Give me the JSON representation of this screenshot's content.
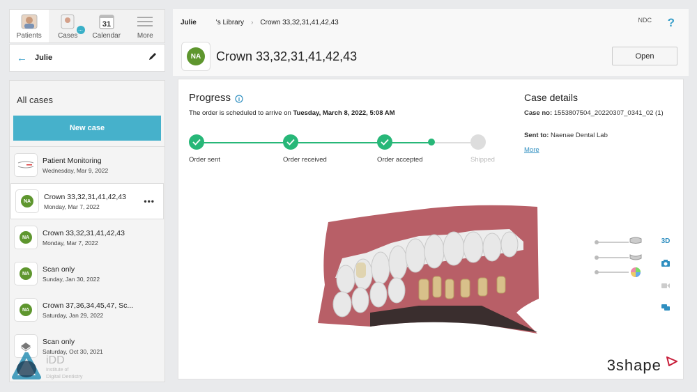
{
  "nav": {
    "tabs": [
      {
        "label": "Patients",
        "icon": "patients-icon"
      },
      {
        "label": "Cases",
        "icon": "cases-icon"
      },
      {
        "label": "Calendar",
        "icon": "calendar-icon"
      },
      {
        "label": "More",
        "icon": "menu-icon"
      }
    ],
    "calendar_day": "31",
    "cases_badge": "..."
  },
  "patient": {
    "name": "Julie"
  },
  "cases_panel": {
    "title": "All cases",
    "new_case_label": "New case",
    "items": [
      {
        "name": "Patient Monitoring",
        "date": "Wednesday, Mar 9, 2022",
        "thumb": "monitoring"
      },
      {
        "name": "Crown 33,32,31,41,42,43",
        "date": "Monday, Mar 7, 2022",
        "thumb": "NA"
      },
      {
        "name": "Crown 33,32,31,41,42,43",
        "date": "Monday, Mar 7, 2022",
        "thumb": "NA"
      },
      {
        "name": "Scan only",
        "date": "Sunday, Jan 30, 2022",
        "thumb": "NA"
      },
      {
        "name": "Crown 37,36,34,45,47, Sc...",
        "date": "Saturday, Jan 29, 2022",
        "thumb": "NA"
      },
      {
        "name": "Scan only",
        "date": "Saturday, Oct 30, 2021",
        "thumb": "scan"
      }
    ],
    "more_icon": "ellipsis-icon"
  },
  "header": {
    "owner": "Julie",
    "library": "'s Library",
    "current": "Crown 33,32,31,41,42,43",
    "ndc": "NDC",
    "help": "?"
  },
  "case": {
    "initials": "NA",
    "title": "Crown 33,32,31,41,42,43",
    "open_label": "Open"
  },
  "progress": {
    "title": "Progress",
    "arrival_prefix": "The order is scheduled to arrive on ",
    "arrival_date": "Tuesday, March 8, 2022, 5:08 AM",
    "steps": [
      {
        "label": "Order sent",
        "done": true
      },
      {
        "label": "Order received",
        "done": true
      },
      {
        "label": "Order accepted",
        "done": true
      },
      {
        "label": "Shipped",
        "done": false
      }
    ]
  },
  "case_details": {
    "title": "Case details",
    "case_no_label": "Case no:",
    "case_no": "1553807504_20220307_0341_02 (1)",
    "sent_to_label": "Sent to:",
    "sent_to": "Naenae Dental Lab",
    "more_label": "More"
  },
  "viewer": {
    "mode_3d": "3D",
    "brand": "3shape"
  },
  "watermark": {
    "line1": "iDD",
    "line2": "Institute of",
    "line3": "Digital Dentistry"
  },
  "colors": {
    "accent": "#46b1cb",
    "success": "#27b778",
    "avatar": "#5e962e",
    "link": "#2f8fc0"
  }
}
